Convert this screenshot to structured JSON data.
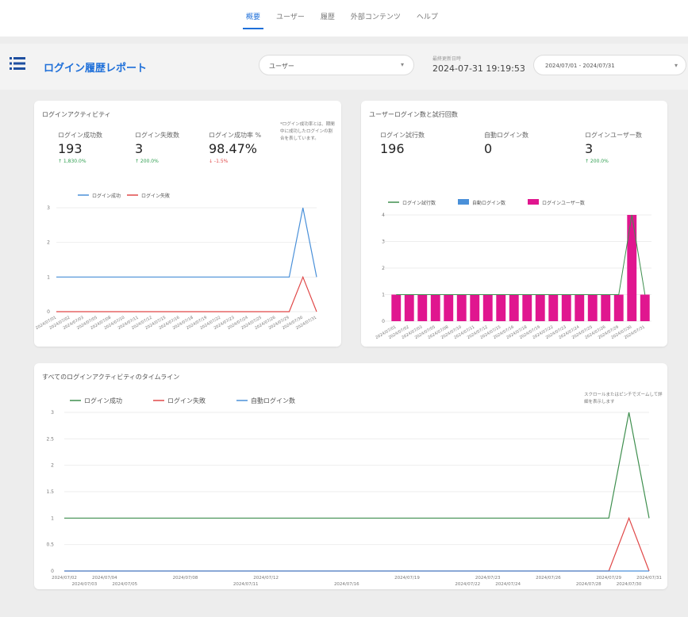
{
  "nav": {
    "tabs": [
      {
        "label": "概要",
        "active": true
      },
      {
        "label": "ユーザー"
      },
      {
        "label": "履歴"
      },
      {
        "label": "外部コンテンツ"
      },
      {
        "label": "ヘルプ"
      }
    ]
  },
  "header": {
    "title": "ログイン履歴レポート",
    "user_select_value": "ユーザー",
    "refresh_label": "最終更新日時",
    "refresh_time": "2024-07-31 19:19:53",
    "date_range": "2024/07/01 - 2024/07/31"
  },
  "card1": {
    "title": "ログインアクティビティ",
    "metrics": [
      {
        "label": "ログイン成功数",
        "value": "193",
        "delta": "↑ 1,830.0%"
      },
      {
        "label": "ログイン失敗数",
        "value": "3",
        "delta": "↑ 200.0%"
      },
      {
        "label": "ログイン成功率 %",
        "value": "98.47%",
        "delta": "↓ -1.5%"
      }
    ],
    "note": "*ログイン成功率とは、期間中に成功したログインの割合を表しています。"
  },
  "card2": {
    "title": "ユーザーログイン数と試行回数",
    "metrics": [
      {
        "label": "ログイン試行数",
        "value": "196",
        "delta": ""
      },
      {
        "label": "自動ログイン数",
        "value": "0",
        "delta": ""
      },
      {
        "label": "ログインユーザー数",
        "value": "3",
        "delta": "↑ 200.0%"
      }
    ]
  },
  "card3": {
    "title": "すべてのログインアクティビティのタイムライン",
    "note": "スクロールまたはピンチでズームして詳細を表示します"
  },
  "colors": {
    "accent": "#1e6fd9",
    "success_line": "#4a90d9",
    "fail_line": "#e04848",
    "bar": "#e0168f",
    "attempt_line": "#3f8f4f",
    "auto_line": "#4a90d9"
  },
  "chart_data": [
    {
      "type": "line",
      "legend": [
        "ログイン成功",
        "ログイン失敗"
      ],
      "x": [
        "2024/07/01",
        "2024/07/02",
        "2024/07/03",
        "2024/07/05",
        "2024/07/08",
        "2024/07/10",
        "2024/07/11",
        "2024/07/12",
        "2024/07/15",
        "2024/07/16",
        "2024/07/18",
        "2024/07/19",
        "2024/07/22",
        "2024/07/23",
        "2024/07/24",
        "2024/07/25",
        "2024/07/26",
        "2024/07/29",
        "2024/07/30",
        "2024/07/31"
      ],
      "series": [
        {
          "name": "ログイン成功",
          "values": [
            1,
            1,
            1,
            1,
            1,
            1,
            1,
            1,
            1,
            1,
            1,
            1,
            1,
            1,
            1,
            1,
            1,
            1,
            3,
            1
          ]
        },
        {
          "name": "ログイン失敗",
          "values": [
            0,
            0,
            0,
            0,
            0,
            0,
            0,
            0,
            0,
            0,
            0,
            0,
            0,
            0,
            0,
            0,
            0,
            0,
            1,
            0
          ]
        }
      ],
      "yticks": [
        "0",
        "1",
        "2",
        "3"
      ],
      "ylim": [
        0,
        3
      ]
    },
    {
      "type": "bar",
      "legend": [
        "ログイン試行数",
        "自動ログイン数",
        "ログインユーザー数"
      ],
      "x": [
        "2024/07/01",
        "2024/07/02",
        "2024/07/03",
        "2024/07/05",
        "2024/07/08",
        "2024/07/10",
        "2024/07/11",
        "2024/07/12",
        "2024/07/15",
        "2024/07/16",
        "2024/07/18",
        "2024/07/19",
        "2024/07/22",
        "2024/07/23",
        "2024/07/24",
        "2024/07/25",
        "2024/07/26",
        "2024/07/29",
        "2024/07/30",
        "2024/07/31"
      ],
      "series": [
        {
          "name": "ログイン試行数",
          "values": [
            1,
            1,
            1,
            1,
            1,
            1,
            1,
            1,
            1,
            1,
            1,
            1,
            1,
            1,
            1,
            1,
            1,
            1,
            4,
            1
          ]
        },
        {
          "name": "自動ログイン数",
          "values": [
            0,
            0,
            0,
            0,
            0,
            0,
            0,
            0,
            0,
            0,
            0,
            0,
            0,
            0,
            0,
            0,
            0,
            0,
            0,
            0
          ]
        },
        {
          "name": "ログインユーザー数",
          "values": [
            1,
            1,
            1,
            1,
            1,
            1,
            1,
            1,
            1,
            1,
            1,
            1,
            1,
            1,
            1,
            1,
            1,
            1,
            4,
            1
          ]
        }
      ],
      "yticks": [
        "0",
        "1",
        "2",
        "3",
        "4"
      ],
      "ylim": [
        0,
        4
      ]
    },
    {
      "type": "line",
      "legend": [
        "ログイン成功",
        "ログイン失敗",
        "自動ログイン数"
      ],
      "x": [
        "2024/07/02",
        "2024/07/03",
        "2024/07/04",
        "2024/07/05",
        "2024/07/08",
        "2024/07/11",
        "2024/07/12",
        "2024/07/16",
        "2024/07/19",
        "2024/07/22",
        "2024/07/23",
        "2024/07/24",
        "2024/07/26",
        "2024/07/28",
        "2024/07/29",
        "2024/07/30",
        "2024/07/31"
      ],
      "x_top": [
        "2024/07/02",
        "2024/07/04",
        "2024/07/08",
        "2024/07/12",
        "2024/07/19",
        "2024/07/23",
        "2024/07/26",
        "2024/07/29",
        "2024/07/31"
      ],
      "x_bottom": [
        "2024/07/03",
        "2024/07/05",
        "2024/07/11",
        "2024/07/16",
        "2024/07/22",
        "2024/07/24",
        "2024/07/28",
        "2024/07/30"
      ],
      "series": [
        {
          "name": "ログイン成功",
          "points": [
            [
              "2024/07/02",
              1
            ],
            [
              "2024/07/29",
              1
            ],
            [
              "2024/07/30",
              3
            ],
            [
              "2024/07/31",
              1
            ]
          ]
        },
        {
          "name": "ログイン失敗",
          "points": [
            [
              "2024/07/02",
              0
            ],
            [
              "2024/07/29",
              0
            ],
            [
              "2024/07/30",
              1
            ],
            [
              "2024/07/31",
              0
            ]
          ]
        },
        {
          "name": "自動ログイン数",
          "points": [
            [
              "2024/07/02",
              0
            ],
            [
              "2024/07/31",
              0
            ]
          ]
        }
      ],
      "yticks": [
        "0",
        "0.5",
        "1",
        "1.5",
        "2",
        "2.5",
        "3"
      ],
      "ylim": [
        0,
        3
      ]
    }
  ]
}
